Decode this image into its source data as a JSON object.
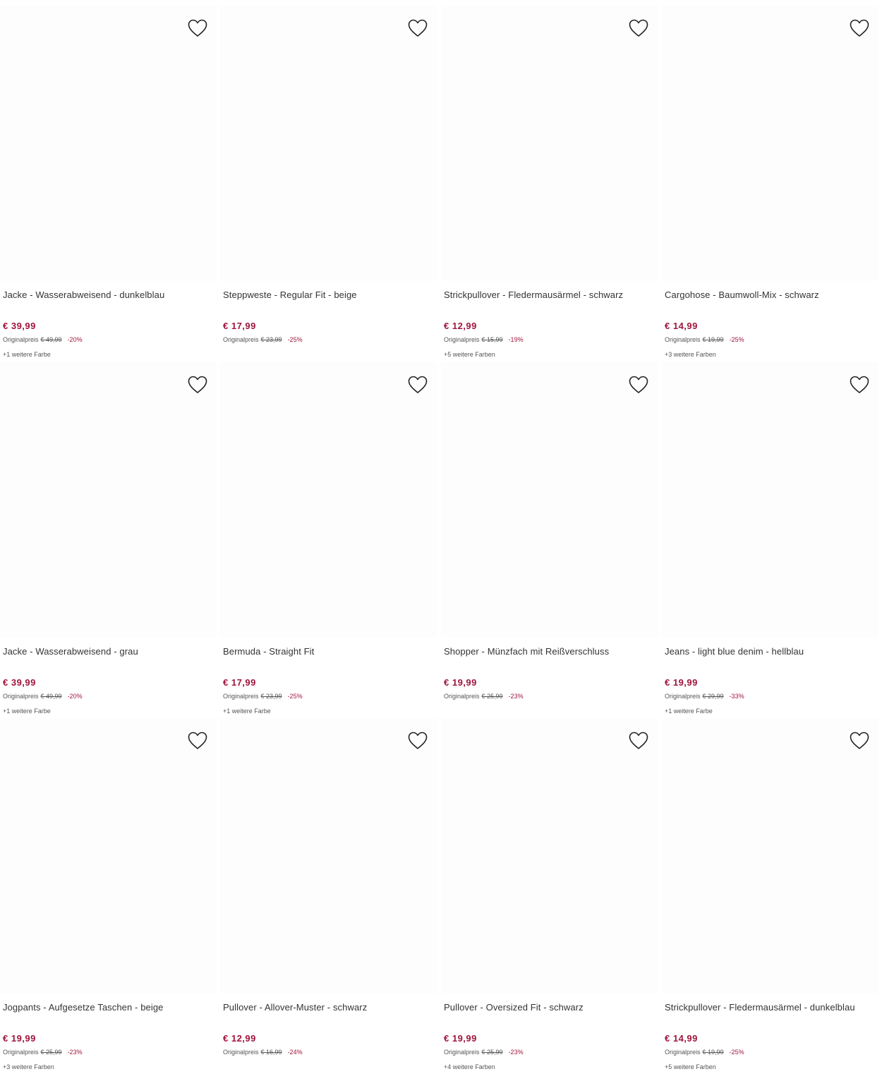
{
  "colors": {
    "price": "#a0143c",
    "text": "#333333",
    "muted": "#555555"
  },
  "products": [
    {
      "title": "Jacke - Wasserabweisend - dunkelblau",
      "price": "€ 39,99",
      "orig_label": "Originalpreis",
      "orig_price": "€ 49,99",
      "discount": "-20%",
      "colors_text": "+1 weitere Farbe"
    },
    {
      "title": "Steppweste - Regular Fit - beige",
      "price": "€ 17,99",
      "orig_label": "Originalpreis",
      "orig_price": "€ 23,99",
      "discount": "-25%",
      "colors_text": ""
    },
    {
      "title": "Strickpullover - Fledermausärmel - schwarz",
      "price": "€ 12,99",
      "orig_label": "Originalpreis",
      "orig_price": "€ 15,99",
      "discount": "-19%",
      "colors_text": "+5 weitere Farben"
    },
    {
      "title": "Cargohose - Baumwoll-Mix - schwarz",
      "price": "€ 14,99",
      "orig_label": "Originalpreis",
      "orig_price": "€ 19,99",
      "discount": "-25%",
      "colors_text": "+3 weitere Farben"
    },
    {
      "title": "Jacke - Wasserabweisend - grau",
      "price": "€ 39,99",
      "orig_label": "Originalpreis",
      "orig_price": "€ 49,99",
      "discount": "-20%",
      "colors_text": "+1 weitere Farbe"
    },
    {
      "title": "Bermuda - Straight Fit",
      "price": "€ 17,99",
      "orig_label": "Originalpreis",
      "orig_price": "€ 23,99",
      "discount": "-25%",
      "colors_text": "+1 weitere Farbe"
    },
    {
      "title": "Shopper - Münzfach mit Reißverschluss",
      "price": "€ 19,99",
      "orig_label": "Originalpreis",
      "orig_price": "€ 25,99",
      "discount": "-23%",
      "colors_text": ""
    },
    {
      "title": "Jeans - light blue denim - hellblau",
      "price": "€ 19,99",
      "orig_label": "Originalpreis",
      "orig_price": "€ 29,99",
      "discount": "-33%",
      "colors_text": "+1 weitere Farbe"
    },
    {
      "title": "Jogpants - Aufgesetze Taschen - beige",
      "price": "€ 19,99",
      "orig_label": "Originalpreis",
      "orig_price": "€ 25,99",
      "discount": "-23%",
      "colors_text": "+3 weitere Farben"
    },
    {
      "title": "Pullover - Allover-Muster - schwarz",
      "price": "€ 12,99",
      "orig_label": "Originalpreis",
      "orig_price": "€ 16,99",
      "discount": "-24%",
      "colors_text": ""
    },
    {
      "title": "Pullover - Oversized Fit - schwarz",
      "price": "€ 19,99",
      "orig_label": "Originalpreis",
      "orig_price": "€ 25,99",
      "discount": "-23%",
      "colors_text": "+4 weitere Farben"
    },
    {
      "title": "Strickpullover - Fledermausärmel - dunkelblau",
      "price": "€ 14,99",
      "orig_label": "Originalpreis",
      "orig_price": "€ 19,99",
      "discount": "-25%",
      "colors_text": "+5 weitere Farben"
    }
  ],
  "icons": {
    "wishlist": "heart-outline-icon"
  }
}
